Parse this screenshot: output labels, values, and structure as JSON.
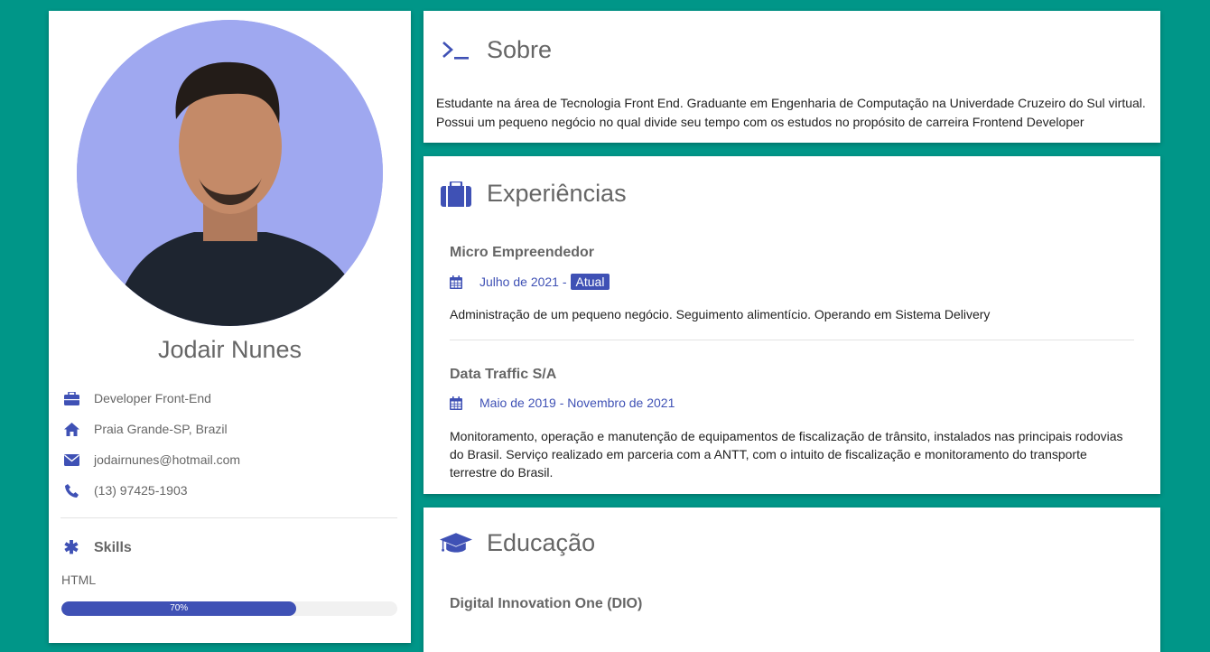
{
  "colors": {
    "accent": "#3f51b5",
    "background": "#009688",
    "avatar_bg": "#9fa8f0"
  },
  "profile": {
    "name": "Jodair Nunes",
    "info": [
      {
        "icon": "briefcase-icon",
        "text": "Developer Front-End"
      },
      {
        "icon": "home-icon",
        "text": "Praia Grande-SP, Brazil"
      },
      {
        "icon": "envelope-icon",
        "text": "jodairnunes@hotmail.com"
      },
      {
        "icon": "phone-icon",
        "text": "(13) 97425-1903"
      }
    ],
    "skills_title": "Skills",
    "skills": [
      {
        "name": "HTML",
        "percent": 70,
        "label": "70%"
      }
    ]
  },
  "sobre": {
    "title": "Sobre",
    "lines": [
      "Estudante na área de Tecnologia Front End. Graduante em Engenharia de Computação na Univerdade Cruzeiro do Sul virtual.",
      "Possui um pequeno negócio no qual divide seu tempo com os estudos no propósito de carreira Frontend Developer"
    ]
  },
  "experiencias": {
    "title": "Experiências",
    "jobs": [
      {
        "title": "Micro Empreendedor",
        "date": "Julho de 2021 -",
        "badge": "Atual",
        "desc": "Administração de um pequeno negócio. Seguimento alimentício. Operando em Sistema Delivery"
      },
      {
        "title": "Data Traffic S/A",
        "date": "Maio de 2019 - Novembro de 2021",
        "desc": "Monitoramento, operação e manutenção de equipamentos de fiscalização de trânsito, instalados nas principais rodovias do Brasil. Serviço realizado em parceria com a ANTT, com o intuito de fiscalização e monitoramento do transporte terrestre do Brasil."
      }
    ]
  },
  "educacao": {
    "title": "Educação",
    "items": [
      {
        "title": "Digital Innovation One (DIO)"
      }
    ]
  }
}
